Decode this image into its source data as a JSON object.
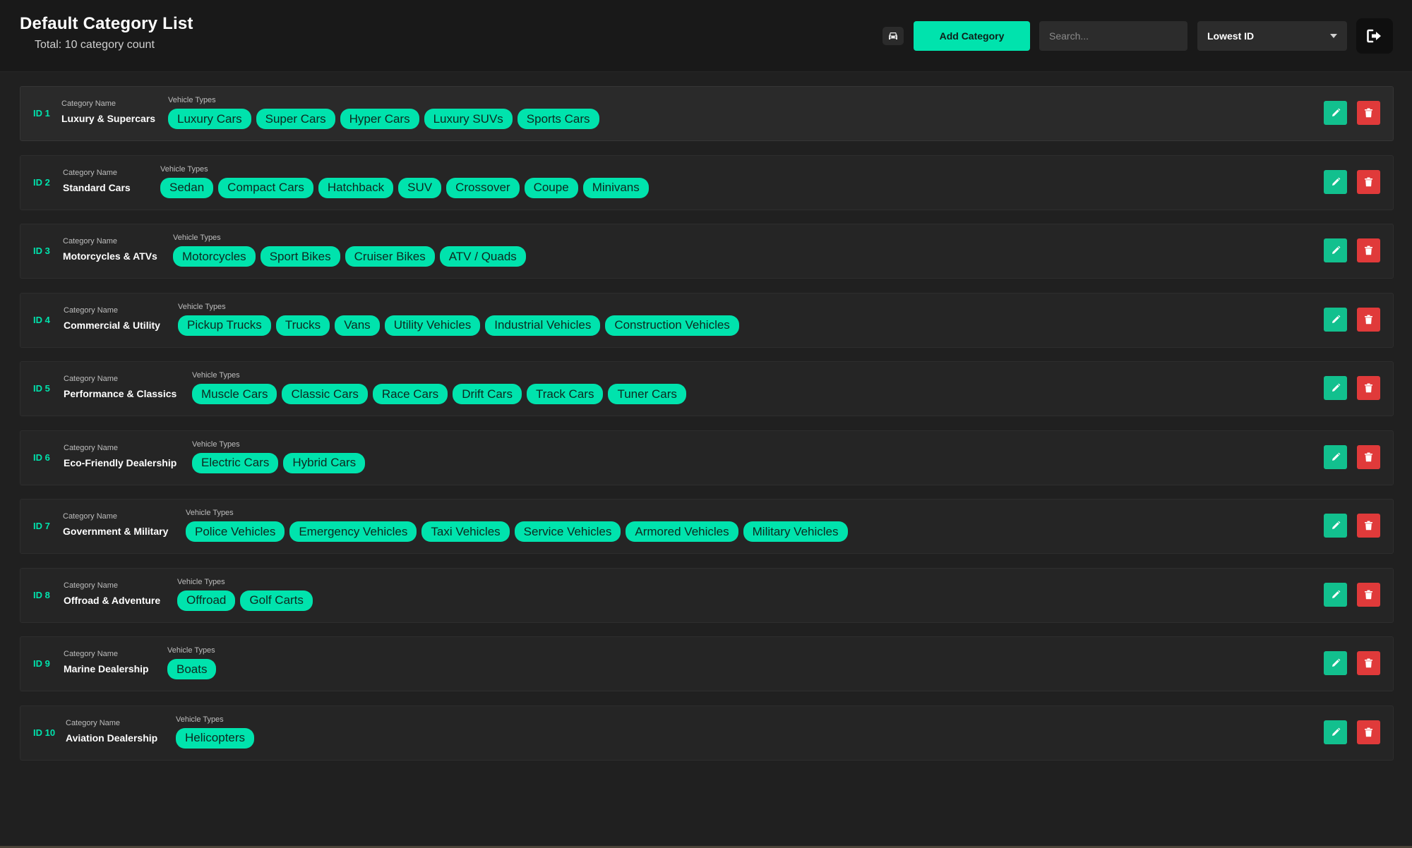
{
  "header": {
    "title": "Default Category List",
    "subtitle": "Total: 10 category count",
    "car_icon": "car-icon",
    "add_button_label": "Add Category",
    "search_placeholder": "Search...",
    "sort_selected": "Lowest ID",
    "logout_icon": "logout-icon"
  },
  "labels": {
    "category_name": "Category Name",
    "vehicle_types": "Vehicle Types"
  },
  "colors": {
    "accent": "#00e3ad",
    "edit": "#12c08e",
    "delete": "#e03a3a",
    "background": "#202020"
  },
  "categories": [
    {
      "id": "ID 1",
      "name": "Luxury & Supercars",
      "types": [
        "Luxury Cars",
        "Super Cars",
        "Hyper Cars",
        "Luxury SUVs",
        "Sports Cars"
      ]
    },
    {
      "id": "ID 2",
      "name": "Standard Cars",
      "types": [
        "Sedan",
        "Compact Cars",
        "Hatchback",
        "SUV",
        "Crossover",
        "Coupe",
        "Minivans"
      ]
    },
    {
      "id": "ID 3",
      "name": "Motorcycles & ATVs",
      "types": [
        "Motorcycles",
        "Sport Bikes",
        "Cruiser Bikes",
        "ATV / Quads"
      ]
    },
    {
      "id": "ID 4",
      "name": "Commercial & Utility",
      "types": [
        "Pickup Trucks",
        "Trucks",
        "Vans",
        "Utility Vehicles",
        "Industrial Vehicles",
        "Construction Vehicles"
      ]
    },
    {
      "id": "ID 5",
      "name": "Performance & Classics",
      "types": [
        "Muscle Cars",
        "Classic Cars",
        "Race Cars",
        "Drift Cars",
        "Track Cars",
        "Tuner Cars"
      ]
    },
    {
      "id": "ID 6",
      "name": "Eco-Friendly Dealership",
      "types": [
        "Electric Cars",
        "Hybrid Cars"
      ]
    },
    {
      "id": "ID 7",
      "name": "Government & Military",
      "types": [
        "Police Vehicles",
        "Emergency Vehicles",
        "Taxi Vehicles",
        "Service Vehicles",
        "Armored Vehicles",
        "Military Vehicles"
      ]
    },
    {
      "id": "ID 8",
      "name": "Offroad & Adventure",
      "types": [
        "Offroad",
        "Golf Carts"
      ]
    },
    {
      "id": "ID 9",
      "name": "Marine Dealership",
      "types": [
        "Boats"
      ]
    },
    {
      "id": "ID 10",
      "name": "Aviation Dealership",
      "types": [
        "Helicopters"
      ]
    }
  ],
  "row_actions": {
    "edit_icon": "pencil-icon",
    "delete_icon": "trash-icon"
  }
}
